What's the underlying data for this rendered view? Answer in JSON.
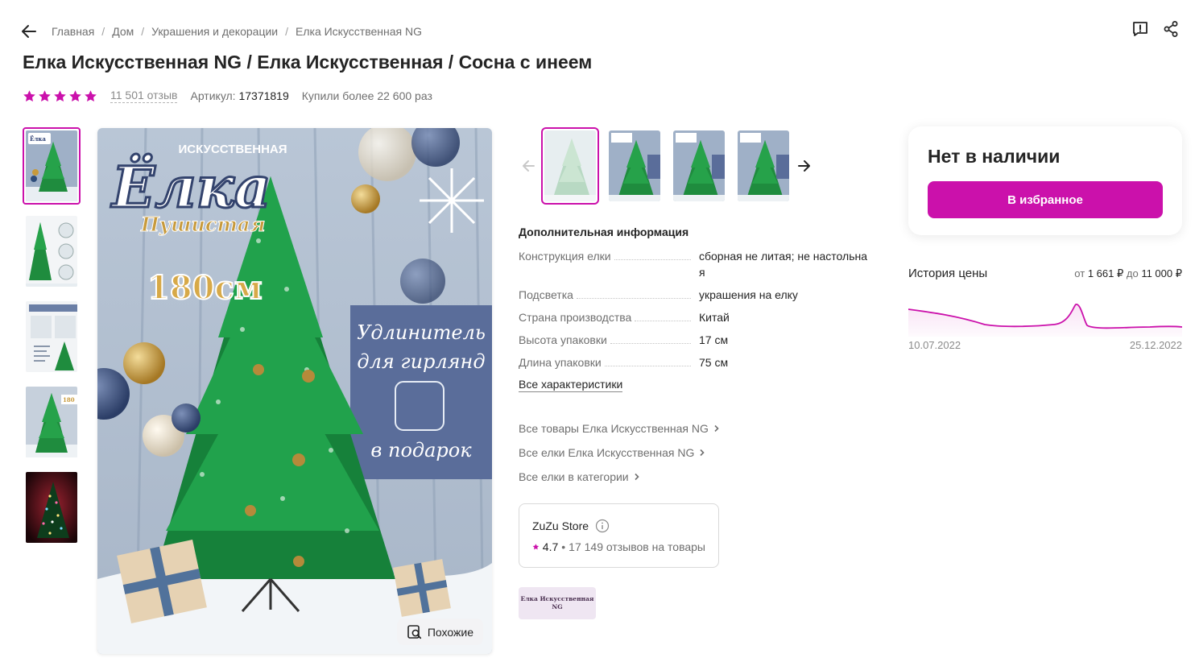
{
  "breadcrumbs": [
    "Главная",
    "Дом",
    "Украшения и декорации",
    "Елка Искусственная NG"
  ],
  "breadcrumb_sep": "/",
  "product": {
    "title": "Елка Искусственная NG / Елка Искусственная / Сосна с инеем",
    "rating_stars": 5,
    "reviews": "11 501 отзыв",
    "article_label": "Артикул:",
    "article": "17371819",
    "bought": "Купили более 22 600 раз"
  },
  "main_image": {
    "similar_label": "Похожие",
    "overlay_texts": [
      "ИСКУССТВЕННАЯ",
      "Ёлка",
      "Пушистая",
      "180см",
      "Удлинитель",
      "для гирлянд",
      "в подарок"
    ]
  },
  "specs": {
    "title": "Дополнительная информация",
    "rows": [
      {
        "key": "Конструкция елки",
        "value": "сборная не литая; не настольная"
      },
      {
        "key": "Подсветка",
        "value": "украшения на елку"
      },
      {
        "key": "Страна производства",
        "value": "Китай"
      },
      {
        "key": "Высота упаковки",
        "value": "17 см"
      },
      {
        "key": "Длина упаковки",
        "value": "75 см"
      }
    ],
    "all_label": "Все характеристики"
  },
  "links": [
    "Все товары Елка Искусственная NG",
    "Все елки Елка Искусственная NG",
    "Все елки в категории"
  ],
  "store": {
    "name": "ZuZu Store",
    "rating": "4.7",
    "reviews": "17 149 отзывов на товары"
  },
  "brand_logo_text": "Елка Искусственная NG",
  "buy": {
    "status": "Нет в наличии",
    "fav_label": "В избранное"
  },
  "price_history": {
    "title": "История цены",
    "range_from_label": "от",
    "range_from": "1 661 ₽",
    "range_to_label": "до",
    "range_to": "11 000 ₽",
    "date_start": "10.07.2022",
    "date_end": "25.12.2022"
  },
  "colors": {
    "accent": "#cb11ab",
    "text": "#242424",
    "muted": "#6f6f6f"
  }
}
